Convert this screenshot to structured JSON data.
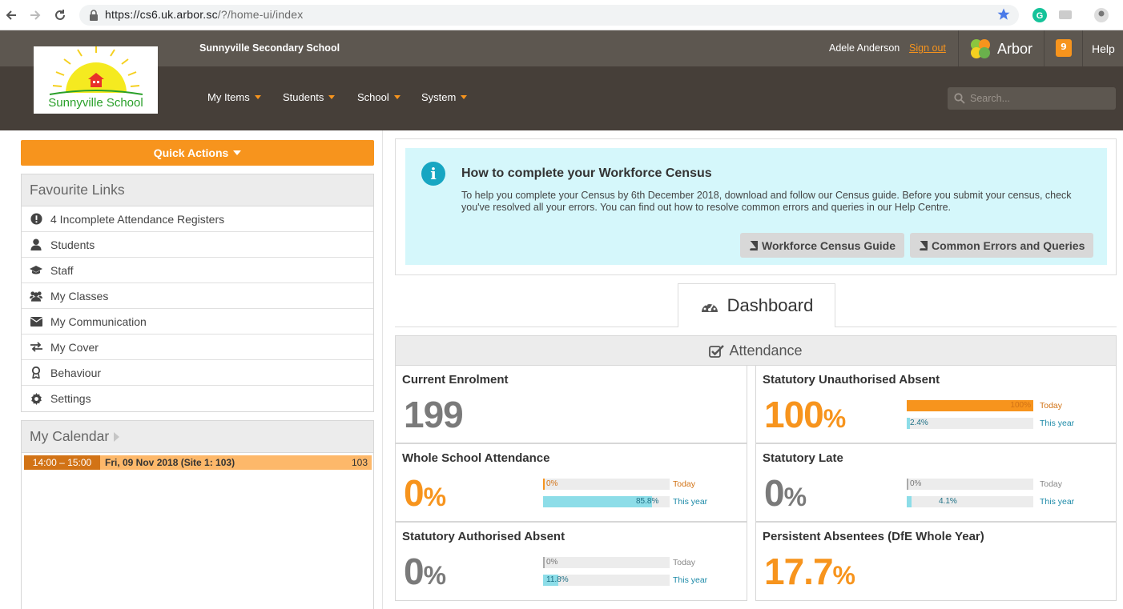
{
  "browser": {
    "url_host": "https://cs6.uk.arbor.sc",
    "url_path": "/?/home-ui/index"
  },
  "header": {
    "school_name": "Sunnyville Secondary School",
    "logo_text": "Sunnyville School",
    "user_name": "Adele Anderson",
    "sign_out": "Sign out",
    "brand": "Arbor",
    "notifications": "9",
    "help": "Help",
    "nav": [
      "My Items",
      "Students",
      "School",
      "System"
    ],
    "search_placeholder": "Search..."
  },
  "quick_actions": "Quick Actions",
  "favourites": {
    "title": "Favourite Links",
    "items": [
      {
        "label": "4 Incomplete Attendance Registers",
        "icon": "exclamation-circle-icon"
      },
      {
        "label": "Students",
        "icon": "user-icon"
      },
      {
        "label": "Staff",
        "icon": "graduation-cap-icon"
      },
      {
        "label": "My Classes",
        "icon": "users-icon"
      },
      {
        "label": "My Communication",
        "icon": "envelope-icon"
      },
      {
        "label": "My Cover",
        "icon": "exchange-icon"
      },
      {
        "label": "Behaviour",
        "icon": "ribbon-icon"
      },
      {
        "label": "Settings",
        "icon": "gear-icon"
      }
    ]
  },
  "calendar": {
    "title": "My Calendar",
    "event": {
      "time": "14:00 – 15:00",
      "title": "Fri, 09 Nov 2018 (Site 1: 103)",
      "room": "103"
    }
  },
  "info": {
    "title": "How to complete your Workforce Census",
    "text": "To help you complete your Census by 6th December 2018, download and follow our Census guide. Before you submit your census, check you've resolved all your errors. You can find out how to resolve common errors and queries in our Help Centre.",
    "btn_guide": "Workforce Census Guide",
    "btn_errors": "Common Errors and Queries"
  },
  "dashboard": {
    "tab": "Dashboard",
    "section": "Attendance",
    "cards": {
      "enrolment": {
        "title": "Current Enrolment",
        "value": "199"
      },
      "unauth": {
        "title": "Statutory Unauthorised Absent",
        "value": "100",
        "unit": "%",
        "today_pct": 100,
        "today_label": "100%",
        "year_pct": 2.4,
        "year_label": "2.4%",
        "today_caption": "Today",
        "year_caption": "This year"
      },
      "whole": {
        "title": "Whole School Attendance",
        "value": "0",
        "unit": "%",
        "today_pct": 0,
        "today_label": "0%",
        "year_pct": 85.8,
        "year_label": "85.8%",
        "today_caption": "Today",
        "year_caption": "This year"
      },
      "late": {
        "title": "Statutory Late",
        "value": "0",
        "unit": "%",
        "today_pct": 0,
        "today_label": "0%",
        "year_pct": 4.1,
        "year_label": "4.1%",
        "today_caption": "Today",
        "year_caption": "This year"
      },
      "auth": {
        "title": "Statutory Authorised Absent",
        "value": "0",
        "unit": "%",
        "today_pct": 0,
        "today_label": "0%",
        "year_pct": 11.8,
        "year_label": "11.8%",
        "today_caption": "Today",
        "year_caption": "This year"
      },
      "persistent": {
        "title": "Persistent Absentees (DfE Whole Year)",
        "value": "17.7",
        "unit": "%"
      }
    }
  },
  "colors": {
    "accent": "#f7941d",
    "bar_year": "#8ddde8",
    "header_dark": "#463f39"
  }
}
